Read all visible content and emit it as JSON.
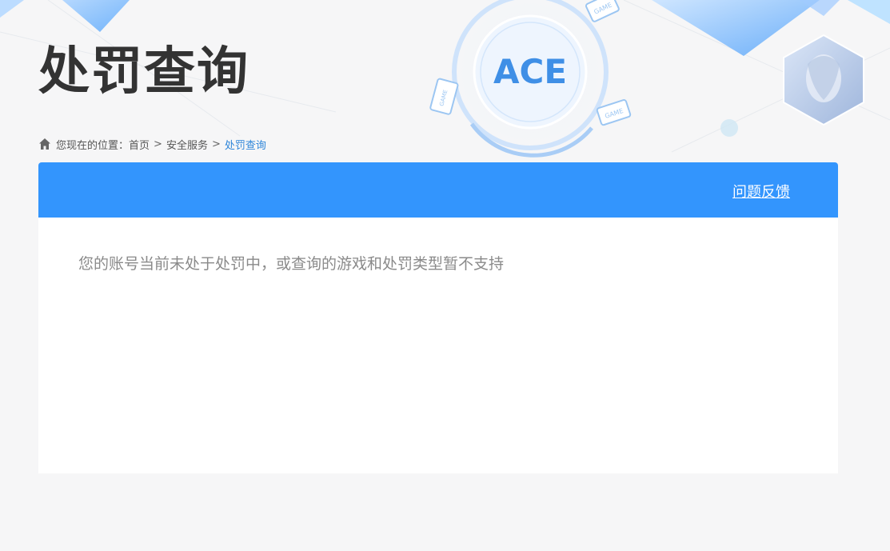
{
  "header": {
    "title": "处罚查询",
    "logo_text": "ACE",
    "badge_text": "GAME"
  },
  "breadcrumb": {
    "prefix": "您现在的位置：",
    "items": [
      {
        "label": "首页"
      },
      {
        "label": "安全服务"
      },
      {
        "label": "处罚查询"
      }
    ],
    "separator": ">"
  },
  "panel": {
    "feedback_label": "问题反馈",
    "message": "您的账号当前未处于处罚中，或查询的游戏和处罚类型暂不支持"
  },
  "colors": {
    "accent": "#3395fd",
    "title": "#333333",
    "message": "#8a8a8a",
    "breadcrumb_current": "#2f86d9",
    "background": "#f6f6f7"
  },
  "icons": {
    "breadcrumb": "home-icon"
  }
}
